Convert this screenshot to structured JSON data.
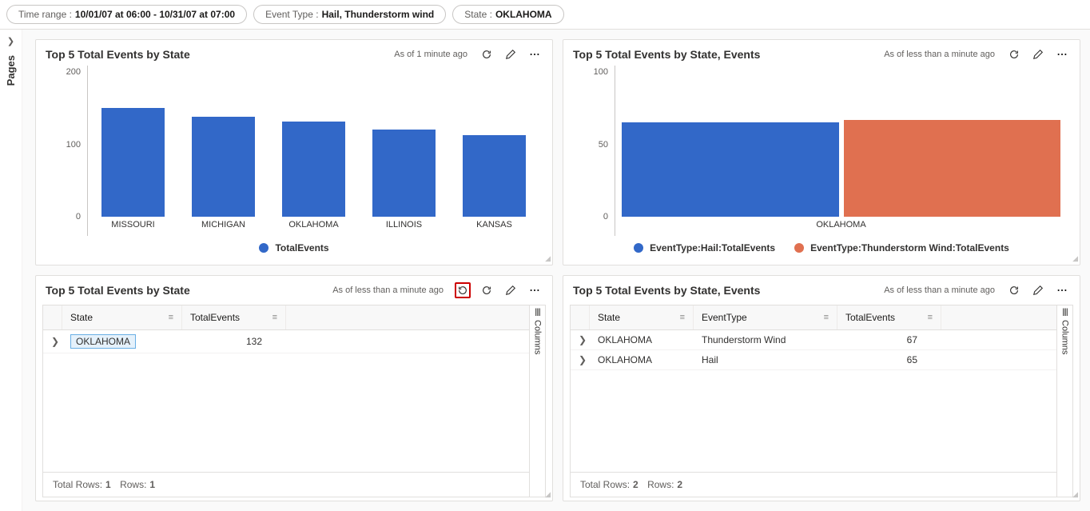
{
  "filters": {
    "time_prefix": "Time range :",
    "time_value": "10/01/07 at 06:00 - 10/31/07 at 07:00",
    "event_prefix": "Event Type :",
    "event_value": "Hail, Thunderstorm wind",
    "state_prefix": "State :",
    "state_value": "OKLAHOMA"
  },
  "pages_label": "Pages",
  "tiles": {
    "tl": {
      "title": "Top 5 Total Events by State",
      "asof": "As of 1 minute ago"
    },
    "tr": {
      "title": "Top 5 Total Events by State, Events",
      "asof": "As of less than a minute ago"
    },
    "bl": {
      "title": "Top 5 Total Events by State",
      "asof": "As of less than a minute ago"
    },
    "br": {
      "title": "Top 5 Total Events by State, Events",
      "asof": "As of less than a minute ago"
    }
  },
  "chart_data": [
    {
      "id": "tl",
      "type": "bar",
      "categories": [
        "MISSOURI",
        "MICHIGAN",
        "OKLAHOMA",
        "ILLINOIS",
        "KANSAS"
      ],
      "values": [
        150,
        138,
        132,
        120,
        113
      ],
      "series_name": "TotalEvents",
      "ylim": [
        0,
        200
      ],
      "yticks": [
        0,
        100,
        200
      ],
      "color": "#3268c8"
    },
    {
      "id": "tr",
      "type": "bar",
      "categories": [
        "OKLAHOMA"
      ],
      "series": [
        {
          "name": "EventType:Hail:TotalEvents",
          "values": [
            65
          ],
          "color": "#3268c8"
        },
        {
          "name": "EventType:Thunderstorm Wind:TotalEvents",
          "values": [
            67
          ],
          "color": "#e07050"
        }
      ],
      "ylim": [
        0,
        100
      ],
      "yticks": [
        0,
        50,
        100
      ]
    }
  ],
  "table_bl": {
    "columns": [
      "State",
      "TotalEvents"
    ],
    "rows": [
      {
        "state": "OKLAHOMA",
        "total": "132",
        "highlight": true
      }
    ],
    "footer_total_label": "Total Rows:",
    "footer_total": "1",
    "footer_rows_label": "Rows:",
    "footer_rows": "1"
  },
  "table_br": {
    "columns": [
      "State",
      "EventType",
      "TotalEvents"
    ],
    "rows": [
      {
        "state": "OKLAHOMA",
        "etype": "Thunderstorm Wind",
        "total": "67"
      },
      {
        "state": "OKLAHOMA",
        "etype": "Hail",
        "total": "65"
      }
    ],
    "footer_total_label": "Total Rows:",
    "footer_total": "2",
    "footer_rows_label": "Rows:",
    "footer_rows": "2"
  },
  "columns_side_label": "Columns"
}
